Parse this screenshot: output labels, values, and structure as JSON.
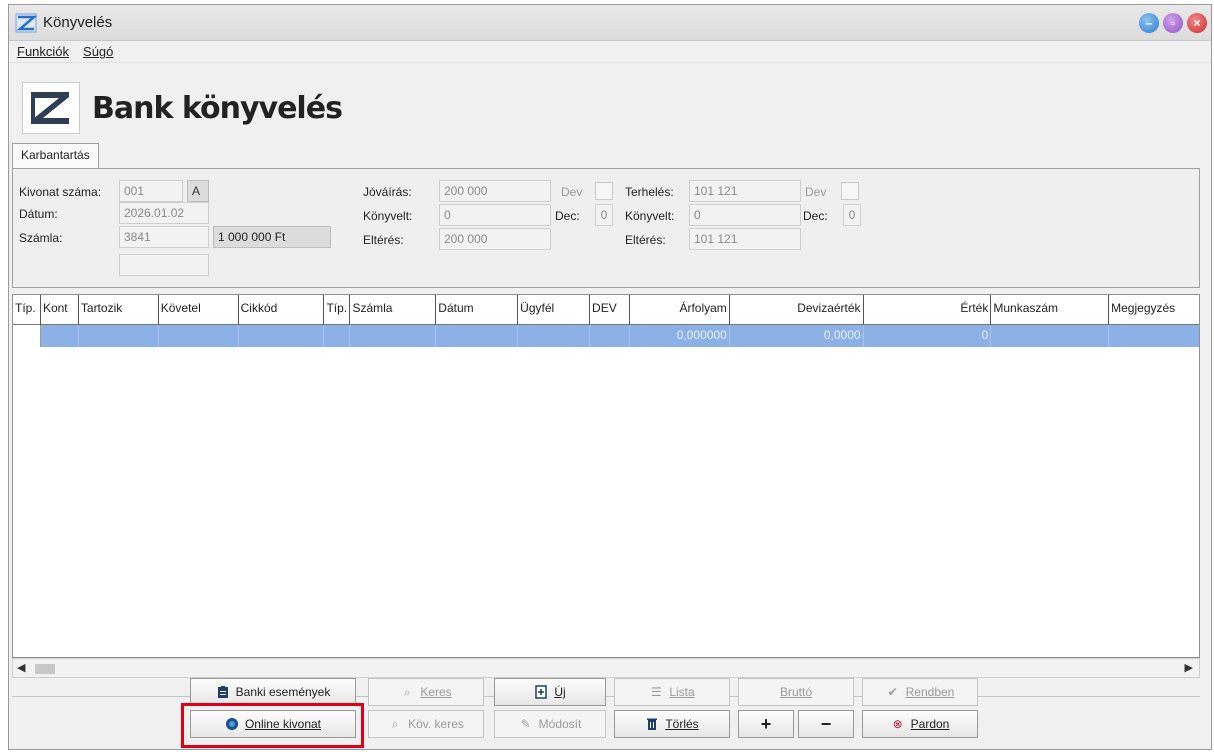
{
  "window": {
    "title": "Könyvelés"
  },
  "menu": {
    "items": [
      "Funkciók",
      "Súgó"
    ]
  },
  "header": {
    "title": "Bank könyvelés"
  },
  "tabs": [
    {
      "label": "Karbantartás"
    }
  ],
  "form": {
    "kivonat_label": "Kivonat száma:",
    "kivonat_value": "001",
    "kivonat_suffix": "A",
    "datum_label": "Dátum:",
    "datum_value": "2026.01.02",
    "szamla_label": "Számla:",
    "szamla_value": "3841",
    "szamla_amount": "1 000 000 Ft",
    "jovairas_label": "Jóváírás:",
    "jovairas_value": "200 000",
    "jovairas_konyvelt_label": "Könyvelt:",
    "jovairas_konyvelt_value": "0",
    "jovairas_elteres_label": "Eltérés:",
    "jovairas_elteres_value": "200 000",
    "jovairas_dev_label": "Dev",
    "jovairas_dec_label": "Dec:",
    "jovairas_dec_value": "0",
    "terheles_label": "Terhelés:",
    "terheles_value": "101 121",
    "terheles_konyvelt_label": "Könyvelt:",
    "terheles_konyvelt_value": "0",
    "terheles_elteres_label": "Eltérés:",
    "terheles_elteres_value": "101 121",
    "terheles_dev_label": "Dev",
    "terheles_dec_label": "Dec:",
    "terheles_dec_value": "0"
  },
  "grid": {
    "columns": [
      "Típ.",
      "Kont",
      "Tartozik",
      "Követel",
      "Cikkód",
      "Típ.",
      "Számla",
      "Dátum",
      "Ügyfél",
      "DEV",
      "Árfolyam",
      "Devizaérték",
      "Érték",
      "Munkaszám",
      "Megjegyzés"
    ],
    "row": {
      "arfolyam": "0,000000",
      "devizaertek": "0,0000",
      "ertek": "0"
    }
  },
  "buttons": {
    "banki_esemenyek": "Banki események",
    "online_kivonat": "Online kivonat",
    "keres": "Keres",
    "kov_keres": "Köv. keres",
    "uj": "Új",
    "modosit": "Módosít",
    "lista": "Lista",
    "torles": "Törlés",
    "brutto": "Bruttó",
    "plus": "+",
    "minus": "−",
    "rendben": "Rendben",
    "pardon": "Pardon"
  },
  "colors": {
    "selection": "#8cb1e6",
    "highlight": "#e0001a"
  }
}
